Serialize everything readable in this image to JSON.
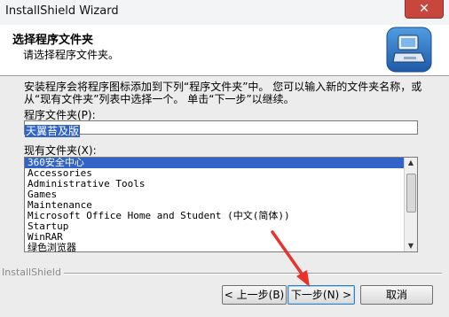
{
  "window": {
    "title": "InstallShield Wizard",
    "close_glyph": "✕"
  },
  "header": {
    "title": "选择程序文件夹",
    "subtitle": "请选择程序文件夹。",
    "logo_icon": "computer-install-icon"
  },
  "instructions": "安装程序会将程序图标添加到下列“程序文件夹”中。 您可以输入新的文件夹名称，或从“现有文件夹”列表中选择一个。 单击“下一步”以继续。",
  "program_folder": {
    "label": "程序文件夹(P):",
    "value": "天翼苔及版"
  },
  "existing_folders": {
    "label": "现有文件夹(X):",
    "items": [
      "360安全中心",
      "Accessories",
      "Administrative Tools",
      "Games",
      "Maintenance",
      "Microsoft Office Home and Student (中文(简体))",
      "Startup",
      "WinRAR",
      "绿色浏览器"
    ],
    "selected_index": 0
  },
  "footer": {
    "brand": "InstallShield"
  },
  "buttons": {
    "back": "< 上一步(B)",
    "next": "下一步(N) >",
    "cancel": "取消"
  },
  "colors": {
    "selection": "#3264c8",
    "annotation_arrow": "#e8322b"
  }
}
